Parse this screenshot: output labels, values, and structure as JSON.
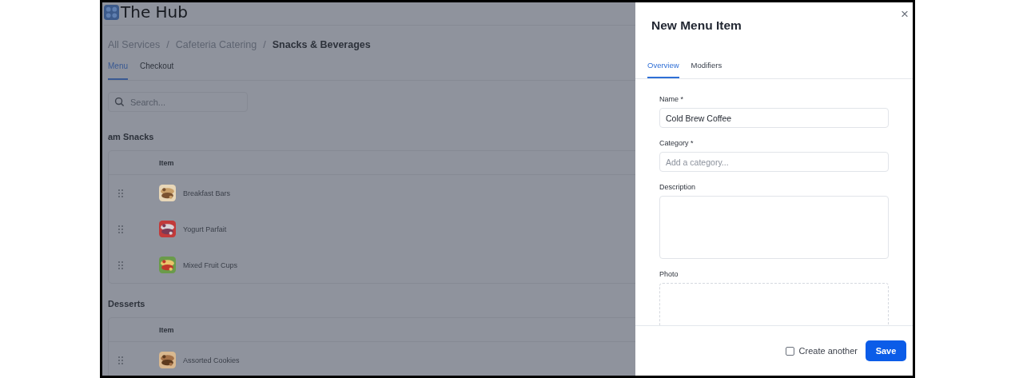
{
  "app": {
    "title": "The Hub"
  },
  "breadcrumb": [
    {
      "label": "All Services",
      "current": false
    },
    {
      "label": "Cafeteria Catering",
      "current": false
    },
    {
      "label": "Snacks & Beverages",
      "current": true
    }
  ],
  "breadcrumb_separators": [
    "/",
    "/"
  ],
  "tabs": [
    {
      "label": "Menu",
      "selected": true
    },
    {
      "label": "Checkout",
      "selected": false
    }
  ],
  "search": {
    "placeholder": "Search..."
  },
  "sections": [
    {
      "title": "am Snacks",
      "columns": [
        "Item"
      ],
      "rows": [
        {
          "item": "Breakfast Bars"
        },
        {
          "item": "Yogurt Parfait"
        },
        {
          "item": "Mixed Fruit Cups"
        }
      ]
    },
    {
      "title": "Desserts",
      "columns": [
        "Item"
      ],
      "rows": [
        {
          "item": "Assorted Cookies"
        }
      ]
    }
  ],
  "drawer": {
    "title": "New Menu Item",
    "close": "×",
    "tabs": [
      {
        "label": "Overview",
        "selected": true
      },
      {
        "label": "Modifiers",
        "selected": false
      }
    ],
    "fields": [
      {
        "label": "Name *",
        "kind": "text",
        "value": "Cold Brew Coffee"
      },
      {
        "label": "Category *",
        "kind": "text",
        "placeholder": "Add a category..."
      },
      {
        "label": "Description",
        "kind": "textarea"
      },
      {
        "label": "Photo",
        "kind": "upload"
      }
    ],
    "create_another": {
      "label": "Create another",
      "checked": false
    },
    "save": "Save"
  }
}
